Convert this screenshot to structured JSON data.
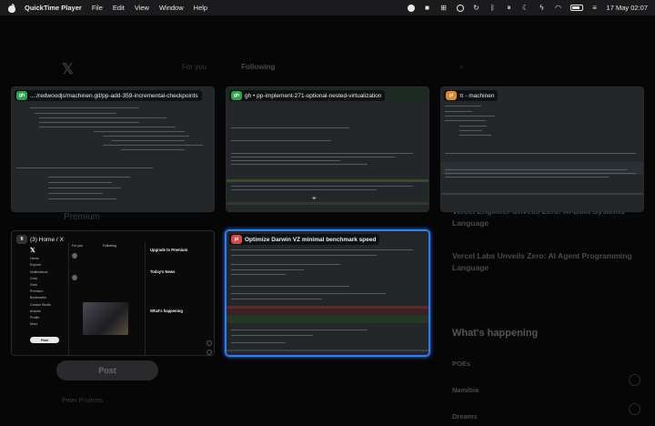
{
  "menubar": {
    "app_name": "QuickTime Player",
    "menus": [
      "File",
      "Edit",
      "View",
      "Window",
      "Help"
    ],
    "clock": "17 May 02:07"
  },
  "background_app": {
    "feed_tabs": [
      "For you",
      "Following"
    ],
    "premium_label": "Premium",
    "post_button": "Post",
    "profile_name": "Peter Pruteres",
    "trends": [
      "Vercel Engineer Unveils Zero: AI-Built Systems Language",
      "Vercel Labs Unveils Zero: AI Agent Programming Language"
    ],
    "whats_happening": "What's happening",
    "small_items": [
      "POEs",
      "Namibia",
      "Dreams"
    ]
  },
  "windows": [
    {
      "title": "...:/redwoodjs/machinen.git/pp-add-359-incremental-checkpoints",
      "badge": "gh",
      "badge_color": "#2ea44f",
      "selected": false
    },
    {
      "title": "gh • pp-implement-271-optional-nested-virtualization",
      "badge": "gh",
      "badge_color": "#2ea44f",
      "selected": false
    },
    {
      "title": "π - machinen",
      "badge": "pi",
      "badge_color": "#e0892b",
      "selected": false
    },
    {
      "title": "(3) Home / X",
      "badge": "fi",
      "badge_color": "#333333",
      "selected": false,
      "nav_items": [
        "Home",
        "Explore",
        "Notifications",
        "Chat",
        "Grok",
        "Premium",
        "Bookmarks",
        "Creator Studio",
        "Articles",
        "Profile",
        "More"
      ],
      "post_label": "Post",
      "feed_tabs": [
        "For you",
        "Following"
      ],
      "sidebar_heading_1": "Upgrade to Premium",
      "sidebar_heading_2": "Today's News",
      "sidebar_heading_3": "What's happening"
    },
    {
      "title": "Optimize Darwin VZ minimal benchmark speed",
      "badge": "pi",
      "badge_color": "#d44a4a",
      "selected": true
    }
  ],
  "colors": {
    "selection_accent": "#2f7cf6",
    "terminal_bg": "#23272a",
    "menubar_bg": "#1b1b1d"
  }
}
